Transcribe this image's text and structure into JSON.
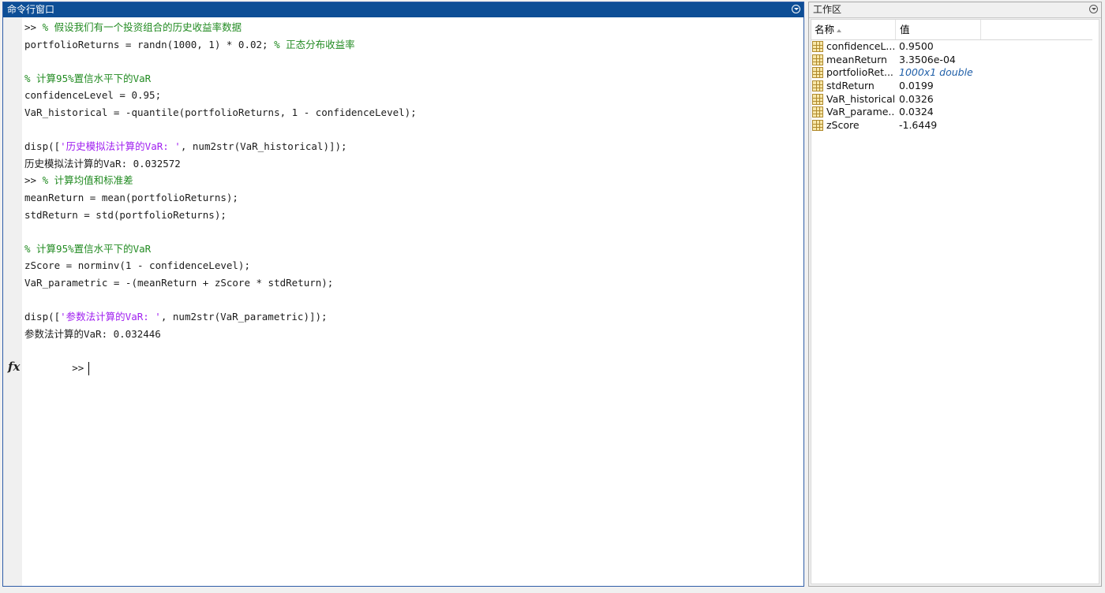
{
  "command_window": {
    "title": "命令行窗口",
    "fx_label": "fx",
    "lines": [
      {
        "parts": [
          {
            "t": ">> ",
            "c": "code"
          },
          {
            "t": "% 假设我们有一个投资组合的历史收益率数据",
            "c": "comment"
          }
        ]
      },
      {
        "parts": [
          {
            "t": "portfolioReturns = randn(1000, 1) * 0.02; ",
            "c": "code"
          },
          {
            "t": "% 正态分布收益率",
            "c": "comment"
          }
        ]
      },
      {
        "parts": []
      },
      {
        "parts": [
          {
            "t": "% 计算95%置信水平下的VaR",
            "c": "comment"
          }
        ]
      },
      {
        "parts": [
          {
            "t": "confidenceLevel = 0.95;",
            "c": "code"
          }
        ]
      },
      {
        "parts": [
          {
            "t": "VaR_historical = -quantile(portfolioReturns, 1 - confidenceLevel);",
            "c": "code"
          }
        ]
      },
      {
        "parts": []
      },
      {
        "parts": [
          {
            "t": "disp([",
            "c": "code"
          },
          {
            "t": "'历史模拟法计算的VaR: '",
            "c": "string"
          },
          {
            "t": ", num2str(VaR_historical)]);",
            "c": "code"
          }
        ]
      },
      {
        "parts": [
          {
            "t": "历史模拟法计算的VaR: 0.032572",
            "c": "code"
          }
        ]
      },
      {
        "parts": [
          {
            "t": ">> ",
            "c": "code"
          },
          {
            "t": "% 计算均值和标准差",
            "c": "comment"
          }
        ]
      },
      {
        "parts": [
          {
            "t": "meanReturn = mean(portfolioReturns);",
            "c": "code"
          }
        ]
      },
      {
        "parts": [
          {
            "t": "stdReturn = std(portfolioReturns);",
            "c": "code"
          }
        ]
      },
      {
        "parts": []
      },
      {
        "parts": [
          {
            "t": "% 计算95%置信水平下的VaR",
            "c": "comment"
          }
        ]
      },
      {
        "parts": [
          {
            "t": "zScore = norminv(1 - confidenceLevel);",
            "c": "code"
          }
        ]
      },
      {
        "parts": [
          {
            "t": "VaR_parametric = -(meanReturn + zScore * stdReturn);",
            "c": "code"
          }
        ]
      },
      {
        "parts": []
      },
      {
        "parts": [
          {
            "t": "disp([",
            "c": "code"
          },
          {
            "t": "'参数法计算的VaR: '",
            "c": "string"
          },
          {
            "t": ", num2str(VaR_parametric)]);",
            "c": "code"
          }
        ]
      },
      {
        "parts": [
          {
            "t": "参数法计算的VaR: 0.032446",
            "c": "code"
          }
        ]
      }
    ],
    "prompt": ">>"
  },
  "workspace": {
    "title": "工作区",
    "col_name": "名称",
    "col_value": "值",
    "variables": [
      {
        "name": "confidenceL...",
        "value": "0.9500",
        "italic": false
      },
      {
        "name": "meanReturn",
        "value": "3.3506e-04",
        "italic": false
      },
      {
        "name": "portfolioRet...",
        "value": "1000x1 double",
        "italic": true
      },
      {
        "name": "stdReturn",
        "value": "0.0199",
        "italic": false
      },
      {
        "name": "VaR_historical",
        "value": "0.0326",
        "italic": false
      },
      {
        "name": "VaR_parame...",
        "value": "0.0324",
        "italic": false
      },
      {
        "name": "zScore",
        "value": "-1.6449",
        "italic": false
      }
    ]
  },
  "colors": {
    "comment": "#228b22",
    "string": "#a020f0",
    "header_blue": "#0d4e96",
    "variable_icon": "#f7e7a8"
  },
  "icons": {
    "command_menu": "chevron-down-circle-icon",
    "workspace_menu": "chevron-down-circle-icon",
    "variable": "matrix-variable-icon",
    "function": "fx-icon"
  }
}
